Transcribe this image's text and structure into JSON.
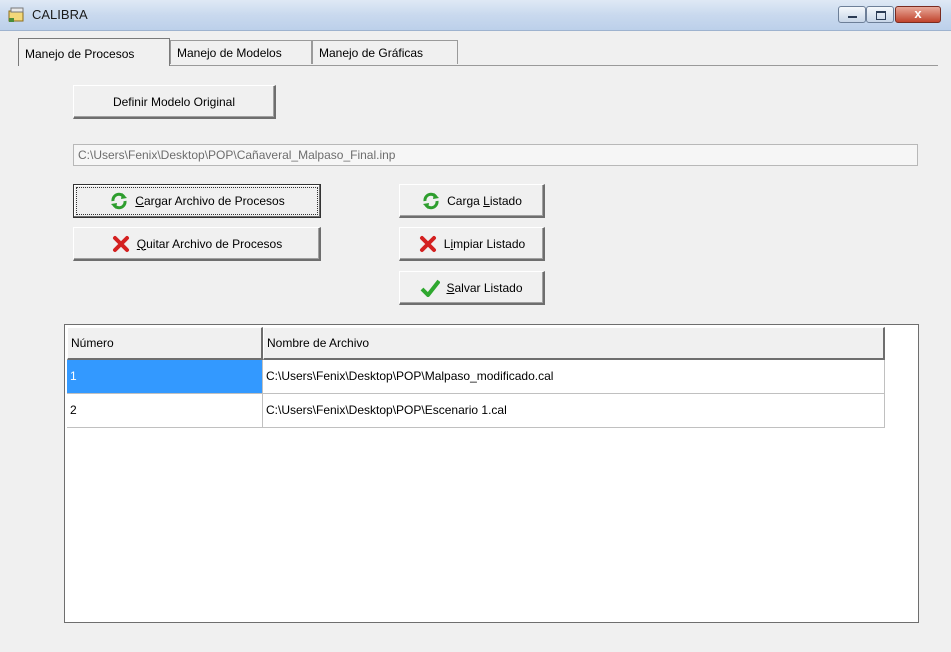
{
  "window": {
    "title": "CALIBRA",
    "controls": {
      "close_glyph": "x"
    }
  },
  "tabs": [
    {
      "label": "Manejo de Procesos",
      "active": true
    },
    {
      "label": "Manejo de Modelos",
      "active": false
    },
    {
      "label": "Manejo de Gráficas",
      "active": false
    }
  ],
  "buttons": {
    "definir_modelo": "Definir Modelo Original",
    "cargar_archivo": {
      "accel": "C",
      "rest": "argar Archivo de Procesos",
      "icon": "refresh-icon"
    },
    "quitar_archivo": {
      "accel": "Q",
      "rest": "uitar Archivo de Procesos",
      "icon": "delete-x-icon"
    },
    "carga_listado": {
      "pre": "Carga ",
      "accel": "L",
      "rest": "istado",
      "icon": "refresh-icon"
    },
    "limpiar_listado": {
      "pre": "L",
      "accel": "i",
      "rest": "mpiar Listado",
      "icon": "delete-x-icon"
    },
    "salvar_listado": {
      "accel": "S",
      "rest": "alvar Listado",
      "icon": "checkmark-icon"
    }
  },
  "model_path": "C:\\Users\\Fenix\\Desktop\\POP\\Cañaveral_Malpaso_Final.inp",
  "table": {
    "columns": [
      "Número",
      "Nombre de Archivo"
    ],
    "rows": [
      {
        "numero": "1",
        "archivo": "C:\\Users\\Fenix\\Desktop\\POP\\Malpaso_modificado.cal",
        "selected": true
      },
      {
        "numero": "2",
        "archivo": "C:\\Users\\Fenix\\Desktop\\POP\\Escenario 1.cal",
        "selected": false
      }
    ]
  },
  "colors": {
    "selection": "#3399ff",
    "refresh_icon": "#2e9e2e",
    "delete_icon": "#d42020",
    "check_icon": "#2fa82f"
  }
}
